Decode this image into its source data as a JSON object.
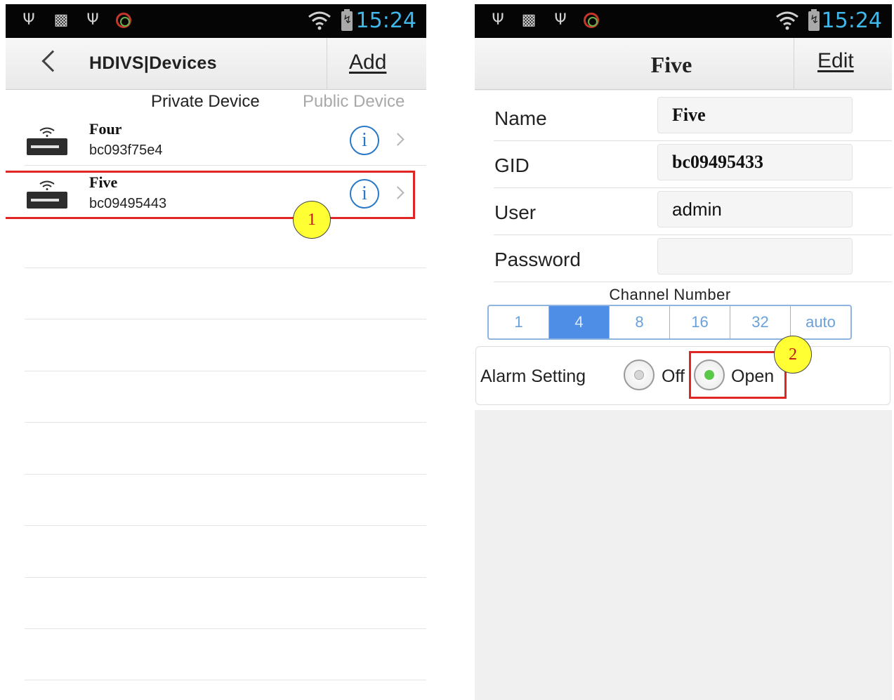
{
  "status_bar": {
    "time": "15:24"
  },
  "left_screen": {
    "nav": {
      "title": "HDIVS|Devices",
      "add_label": "Add"
    },
    "tabs": {
      "private": "Private Device",
      "public": "Public Device"
    },
    "devices": [
      {
        "name": "Four",
        "gid": "bc093f75e4",
        "info": "i"
      },
      {
        "name": "Five",
        "gid": "bc09495443",
        "info": "i"
      }
    ],
    "step_badge": "1"
  },
  "right_screen": {
    "nav": {
      "title": "Five",
      "edit_label": "Edit"
    },
    "fields": {
      "name_label": "Name",
      "name_value": "Five",
      "gid_label": "GID",
      "gid_value": "bc09495433",
      "user_label": "User",
      "user_value": "admin",
      "password_label": "Password",
      "password_value": ""
    },
    "channel": {
      "label": "Channel Number",
      "options": [
        "1",
        "4",
        "8",
        "16",
        "32",
        "auto"
      ],
      "selected": "4"
    },
    "alarm": {
      "label": "Alarm Setting",
      "off_label": "Off",
      "open_label": "Open",
      "selected": "Open"
    },
    "step_badge": "2"
  },
  "colors": {
    "status_time": "#3fb7e8",
    "info_blue": "#2a78c8",
    "segment_selected": "#4f8ee6",
    "highlight_red": "#e02525",
    "badge_yellow": "#ffff33",
    "radio_on": "#5cc84a"
  }
}
